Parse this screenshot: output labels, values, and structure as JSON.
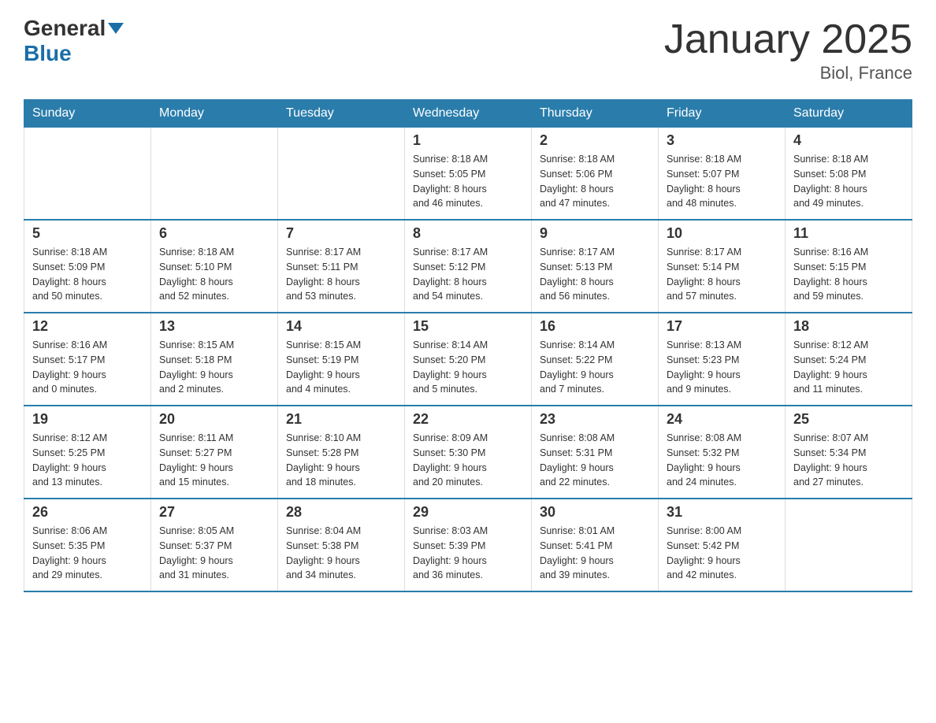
{
  "header": {
    "logo_general": "General",
    "logo_blue": "Blue",
    "title": "January 2025",
    "subtitle": "Biol, France"
  },
  "days_of_week": [
    "Sunday",
    "Monday",
    "Tuesday",
    "Wednesday",
    "Thursday",
    "Friday",
    "Saturday"
  ],
  "weeks": [
    [
      {
        "day": "",
        "info": ""
      },
      {
        "day": "",
        "info": ""
      },
      {
        "day": "",
        "info": ""
      },
      {
        "day": "1",
        "info": "Sunrise: 8:18 AM\nSunset: 5:05 PM\nDaylight: 8 hours\nand 46 minutes."
      },
      {
        "day": "2",
        "info": "Sunrise: 8:18 AM\nSunset: 5:06 PM\nDaylight: 8 hours\nand 47 minutes."
      },
      {
        "day": "3",
        "info": "Sunrise: 8:18 AM\nSunset: 5:07 PM\nDaylight: 8 hours\nand 48 minutes."
      },
      {
        "day": "4",
        "info": "Sunrise: 8:18 AM\nSunset: 5:08 PM\nDaylight: 8 hours\nand 49 minutes."
      }
    ],
    [
      {
        "day": "5",
        "info": "Sunrise: 8:18 AM\nSunset: 5:09 PM\nDaylight: 8 hours\nand 50 minutes."
      },
      {
        "day": "6",
        "info": "Sunrise: 8:18 AM\nSunset: 5:10 PM\nDaylight: 8 hours\nand 52 minutes."
      },
      {
        "day": "7",
        "info": "Sunrise: 8:17 AM\nSunset: 5:11 PM\nDaylight: 8 hours\nand 53 minutes."
      },
      {
        "day": "8",
        "info": "Sunrise: 8:17 AM\nSunset: 5:12 PM\nDaylight: 8 hours\nand 54 minutes."
      },
      {
        "day": "9",
        "info": "Sunrise: 8:17 AM\nSunset: 5:13 PM\nDaylight: 8 hours\nand 56 minutes."
      },
      {
        "day": "10",
        "info": "Sunrise: 8:17 AM\nSunset: 5:14 PM\nDaylight: 8 hours\nand 57 minutes."
      },
      {
        "day": "11",
        "info": "Sunrise: 8:16 AM\nSunset: 5:15 PM\nDaylight: 8 hours\nand 59 minutes."
      }
    ],
    [
      {
        "day": "12",
        "info": "Sunrise: 8:16 AM\nSunset: 5:17 PM\nDaylight: 9 hours\nand 0 minutes."
      },
      {
        "day": "13",
        "info": "Sunrise: 8:15 AM\nSunset: 5:18 PM\nDaylight: 9 hours\nand 2 minutes."
      },
      {
        "day": "14",
        "info": "Sunrise: 8:15 AM\nSunset: 5:19 PM\nDaylight: 9 hours\nand 4 minutes."
      },
      {
        "day": "15",
        "info": "Sunrise: 8:14 AM\nSunset: 5:20 PM\nDaylight: 9 hours\nand 5 minutes."
      },
      {
        "day": "16",
        "info": "Sunrise: 8:14 AM\nSunset: 5:22 PM\nDaylight: 9 hours\nand 7 minutes."
      },
      {
        "day": "17",
        "info": "Sunrise: 8:13 AM\nSunset: 5:23 PM\nDaylight: 9 hours\nand 9 minutes."
      },
      {
        "day": "18",
        "info": "Sunrise: 8:12 AM\nSunset: 5:24 PM\nDaylight: 9 hours\nand 11 minutes."
      }
    ],
    [
      {
        "day": "19",
        "info": "Sunrise: 8:12 AM\nSunset: 5:25 PM\nDaylight: 9 hours\nand 13 minutes."
      },
      {
        "day": "20",
        "info": "Sunrise: 8:11 AM\nSunset: 5:27 PM\nDaylight: 9 hours\nand 15 minutes."
      },
      {
        "day": "21",
        "info": "Sunrise: 8:10 AM\nSunset: 5:28 PM\nDaylight: 9 hours\nand 18 minutes."
      },
      {
        "day": "22",
        "info": "Sunrise: 8:09 AM\nSunset: 5:30 PM\nDaylight: 9 hours\nand 20 minutes."
      },
      {
        "day": "23",
        "info": "Sunrise: 8:08 AM\nSunset: 5:31 PM\nDaylight: 9 hours\nand 22 minutes."
      },
      {
        "day": "24",
        "info": "Sunrise: 8:08 AM\nSunset: 5:32 PM\nDaylight: 9 hours\nand 24 minutes."
      },
      {
        "day": "25",
        "info": "Sunrise: 8:07 AM\nSunset: 5:34 PM\nDaylight: 9 hours\nand 27 minutes."
      }
    ],
    [
      {
        "day": "26",
        "info": "Sunrise: 8:06 AM\nSunset: 5:35 PM\nDaylight: 9 hours\nand 29 minutes."
      },
      {
        "day": "27",
        "info": "Sunrise: 8:05 AM\nSunset: 5:37 PM\nDaylight: 9 hours\nand 31 minutes."
      },
      {
        "day": "28",
        "info": "Sunrise: 8:04 AM\nSunset: 5:38 PM\nDaylight: 9 hours\nand 34 minutes."
      },
      {
        "day": "29",
        "info": "Sunrise: 8:03 AM\nSunset: 5:39 PM\nDaylight: 9 hours\nand 36 minutes."
      },
      {
        "day": "30",
        "info": "Sunrise: 8:01 AM\nSunset: 5:41 PM\nDaylight: 9 hours\nand 39 minutes."
      },
      {
        "day": "31",
        "info": "Sunrise: 8:00 AM\nSunset: 5:42 PM\nDaylight: 9 hours\nand 42 minutes."
      },
      {
        "day": "",
        "info": ""
      }
    ]
  ]
}
